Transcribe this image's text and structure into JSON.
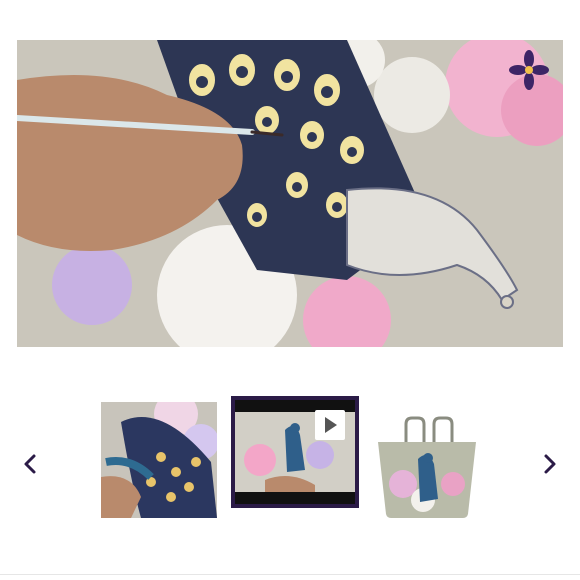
{
  "gallery": {
    "main_image": {
      "kind": "photo",
      "subject": "hand-painting-peacock-artwork"
    },
    "thumbnails": [
      {
        "kind": "photo",
        "subject": "peacock-painting-detail",
        "selected": false
      },
      {
        "kind": "video",
        "subject": "painting-process-video",
        "selected": true
      },
      {
        "kind": "photo",
        "subject": "peacock-tote-bag",
        "selected": false
      }
    ],
    "nav": {
      "prev_icon": "chevron-left-icon",
      "next_icon": "chevron-right-icon"
    },
    "colors": {
      "accent": "#2b1b47",
      "canvas": "#cfcbc0"
    }
  }
}
